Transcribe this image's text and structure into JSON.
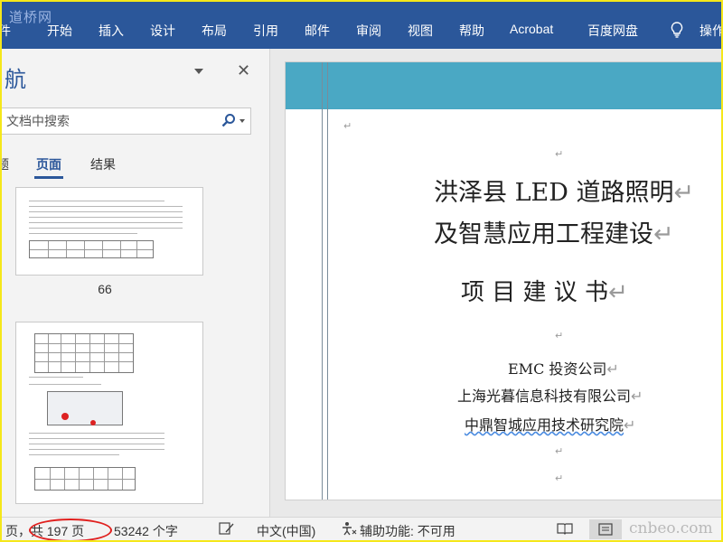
{
  "ribbon": {
    "watermark": "道桥网",
    "tabs": [
      "件",
      "开始",
      "插入",
      "设计",
      "布局",
      "引用",
      "邮件",
      "审阅",
      "视图",
      "帮助",
      "Acrobat",
      "百度网盘",
      "操作"
    ]
  },
  "nav": {
    "title": "航",
    "search_placeholder": "文档中搜索",
    "tabs": [
      "题",
      "页面",
      "结果"
    ],
    "active_tab": "页面",
    "thumb_page_label": "66"
  },
  "document": {
    "paragraph_mark": "↵",
    "title_line1": "洪泽县 LED 道路照明",
    "title_line2": "及智慧应用工程建设",
    "subtitle": "项 目 建 议 书",
    "company1": "EMC 投资公司",
    "company2": "上海光暮信息科技有限公司",
    "company3": "中鼎智城应用技术研究院"
  },
  "status": {
    "page_info": "页，共 197 页",
    "word_count": "53242 个字",
    "language": "中文(中国)",
    "accessibility": "辅助功能: 不可用",
    "watermark": "cnbeo.com",
    "highlight_color": "#e0201e"
  },
  "colors": {
    "ribbon": "#2b579a",
    "header_band": "#4aa8c4",
    "frame": "#f5e71a"
  }
}
